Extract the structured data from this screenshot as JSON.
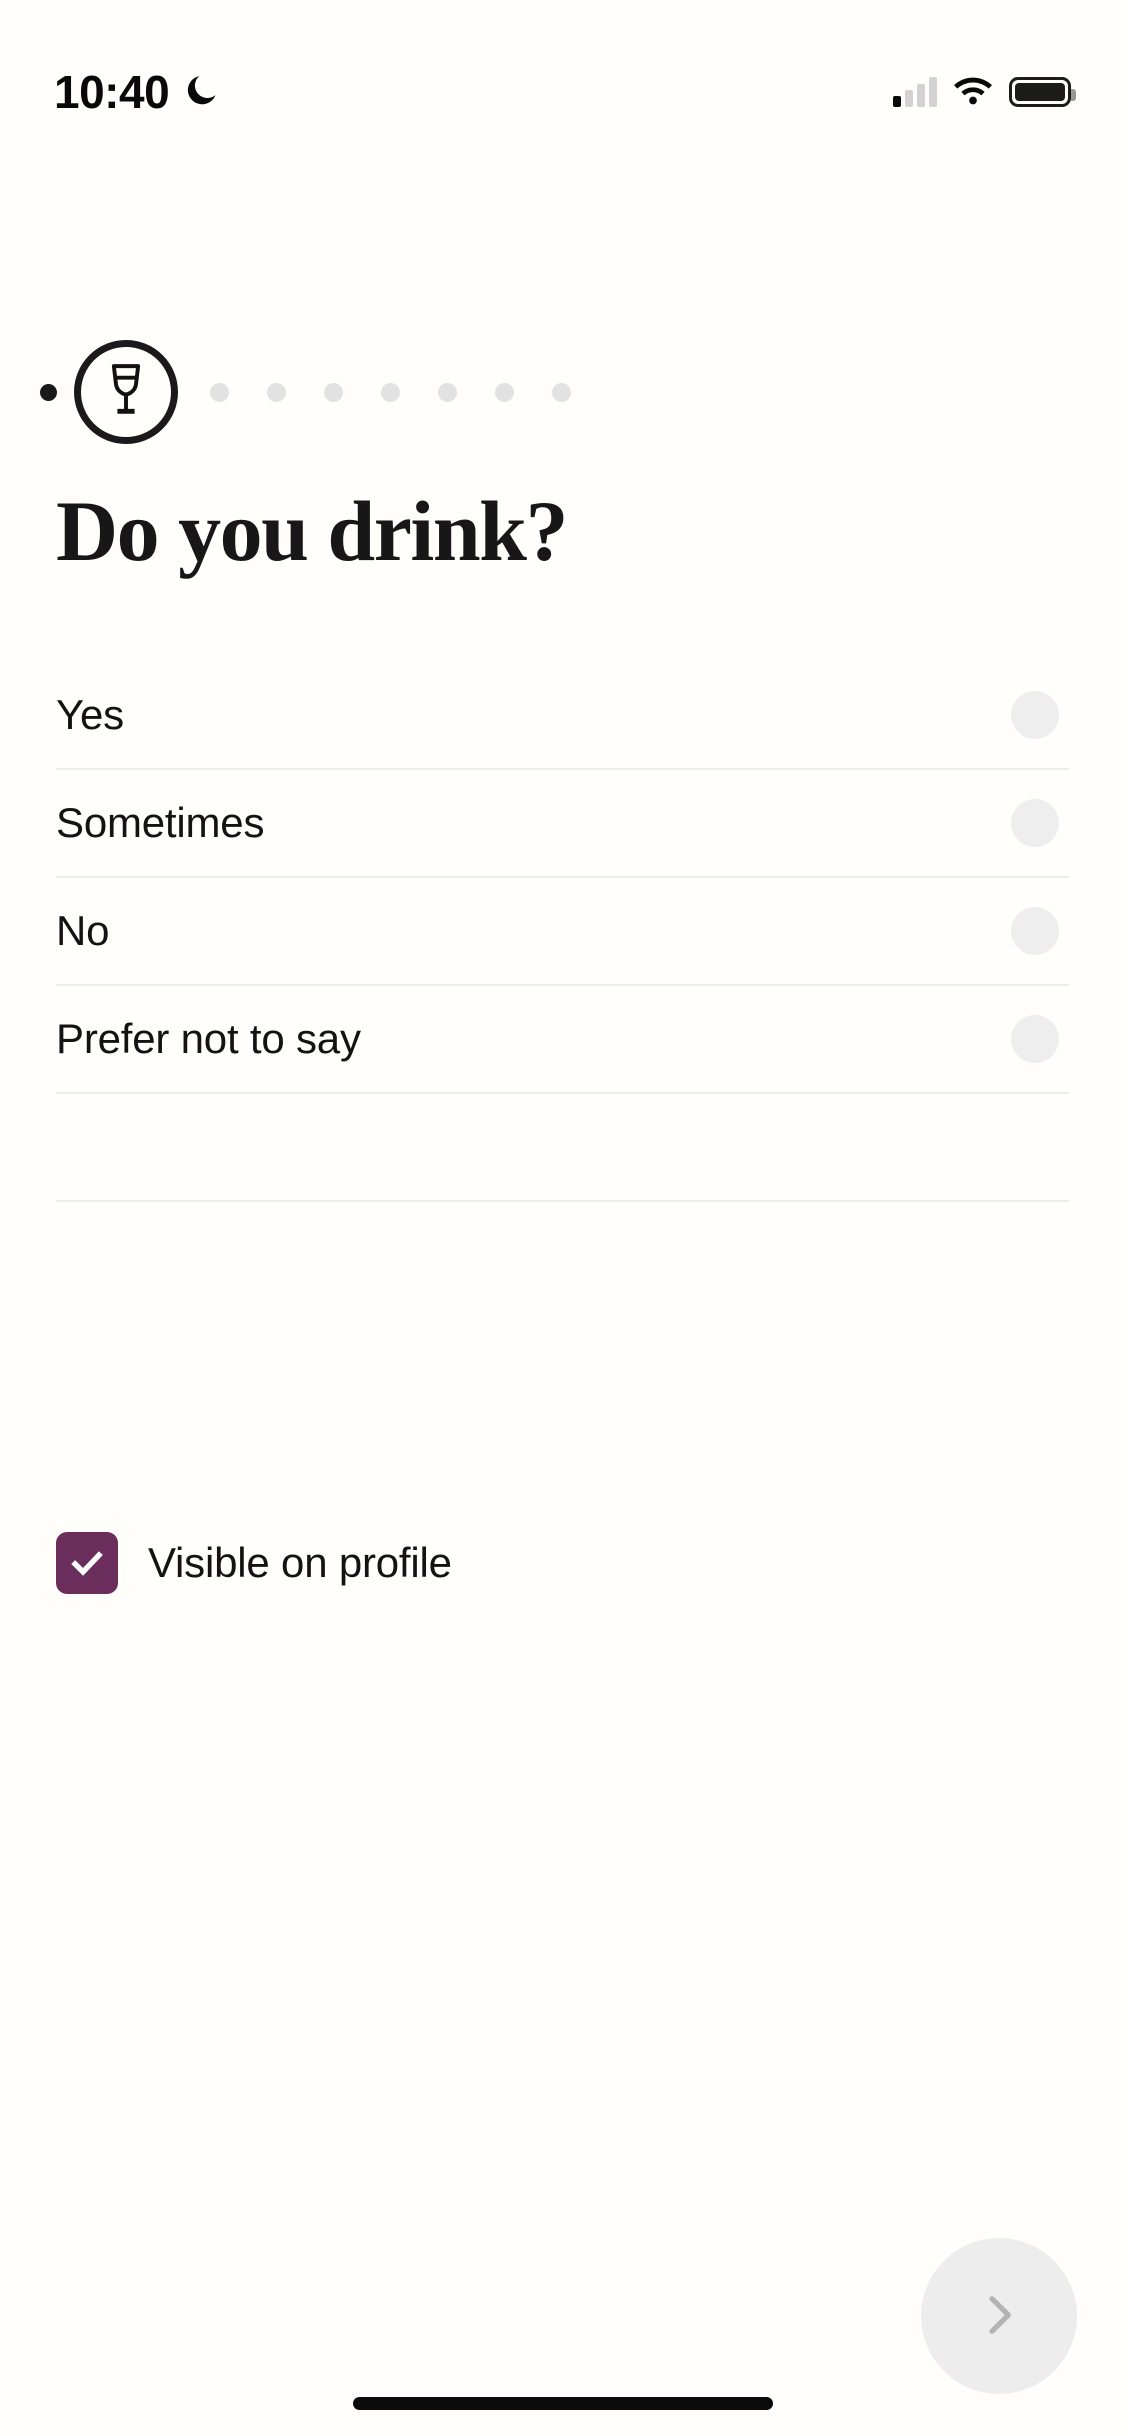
{
  "status_bar": {
    "time": "10:40",
    "dnd_icon": "moon-icon",
    "cellular_icon": "cellular-signal-icon",
    "cellular_bars_filled": 1,
    "cellular_bars_total": 4,
    "wifi_icon": "wifi-icon",
    "battery_icon": "battery-full-icon",
    "battery_level_percent": 100
  },
  "stepper": {
    "completed_dot": "progress-dot-completed",
    "current_step_icon": "wine-glass-icon",
    "current_step_index": 2,
    "total_steps": 9,
    "remaining_dots": 7
  },
  "question": {
    "title": "Do you drink?"
  },
  "options": [
    {
      "label": "Yes",
      "selected": false,
      "radio_icon": "radio-unselected-icon"
    },
    {
      "label": "Sometimes",
      "selected": false,
      "radio_icon": "radio-unselected-icon"
    },
    {
      "label": "No",
      "selected": false,
      "radio_icon": "radio-unselected-icon"
    },
    {
      "label": "Prefer not to say",
      "selected": false,
      "radio_icon": "radio-unselected-icon"
    }
  ],
  "visibility": {
    "label": "Visible on profile",
    "checked": true,
    "check_icon": "checkmark-icon",
    "checkbox_color": "#6B2D5C"
  },
  "next_button": {
    "icon": "chevron-right-icon",
    "label": "",
    "background_color": "#EDEDED",
    "icon_color": "#B3B3B3"
  },
  "home_indicator": {
    "name": "home-indicator"
  },
  "colors": {
    "background": "#FFFEFB",
    "text_primary": "#131313",
    "divider": "#EDEDED",
    "radio_fill": "#EEEEEE",
    "accent_purple": "#6B2D5C",
    "inactive_dot": "#E2E2E2"
  }
}
